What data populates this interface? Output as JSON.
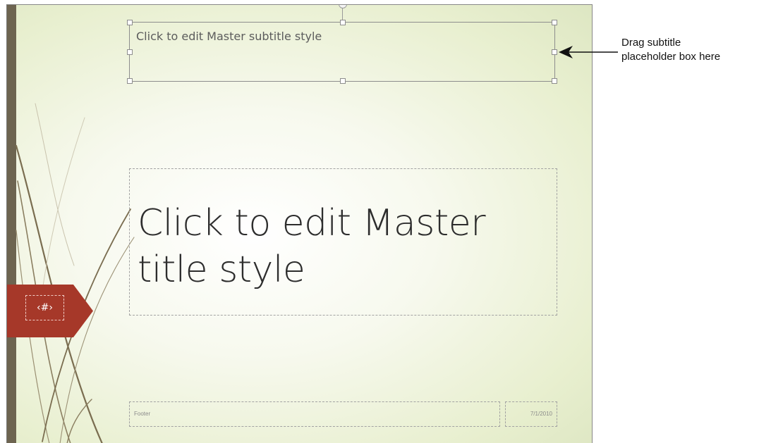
{
  "subtitle_placeholder": {
    "text": "Click to edit Master subtitle style"
  },
  "title_placeholder": {
    "line1": "Click to edit Master",
    "line2": "title style"
  },
  "slide_number_tag": {
    "text": "‹#›",
    "color": "#a63829"
  },
  "footer_placeholder": {
    "text": "Footer"
  },
  "date_placeholder": {
    "text": "7/1/2010"
  },
  "callout": {
    "line1": "Drag subtitle",
    "line2": "placeholder box here"
  },
  "colors": {
    "left_bar": "#6d6450",
    "slide_bg": "#f7f9ee"
  },
  "icons": {
    "callout_arrow": "arrow-left-icon",
    "rotation_handle": "rotate-handle-icon"
  }
}
